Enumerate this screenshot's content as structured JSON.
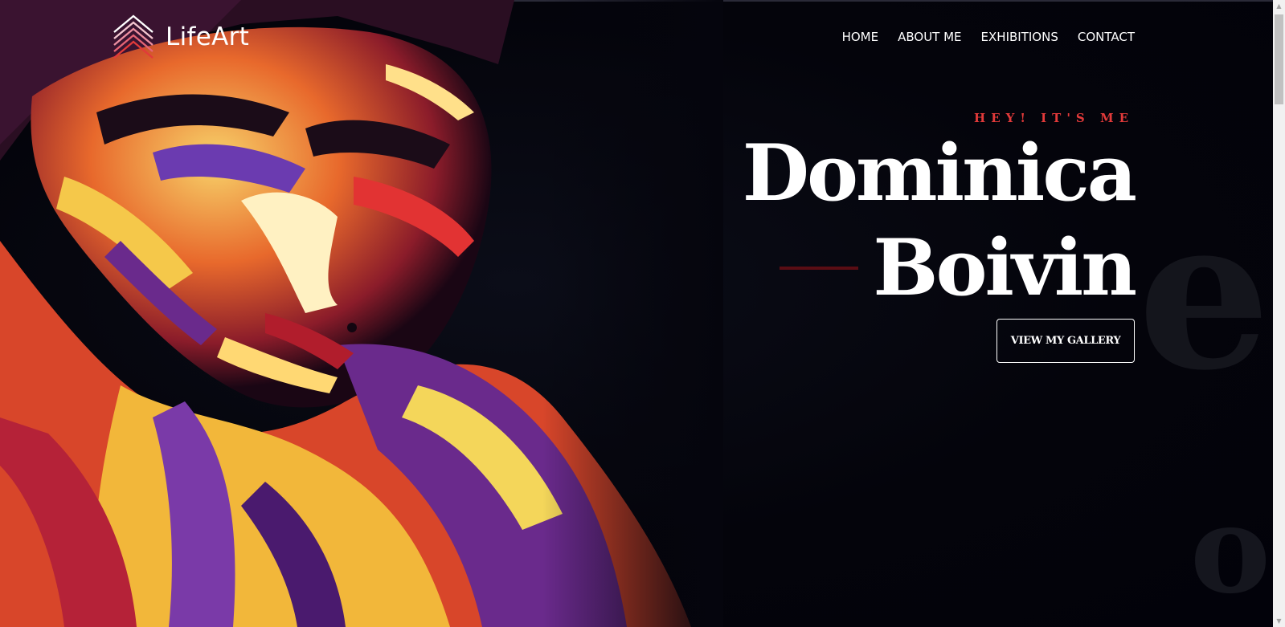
{
  "brand": {
    "name": "LifeArt",
    "logo_icon": "chevron-stripes-icon",
    "accent_color": "#e23a3a"
  },
  "nav": {
    "items": [
      "HOME",
      "ABOUT ME",
      "EXHIBITIONS",
      "CONTACT"
    ]
  },
  "hero": {
    "eyebrow": "HEY! IT'S ME",
    "first_name": "Dominica",
    "last_name": "Boivin",
    "cta_label": "VIEW MY GALLERY",
    "image": "body-painted-portrait"
  },
  "scrollbar": {
    "position_fraction": 0.0
  }
}
